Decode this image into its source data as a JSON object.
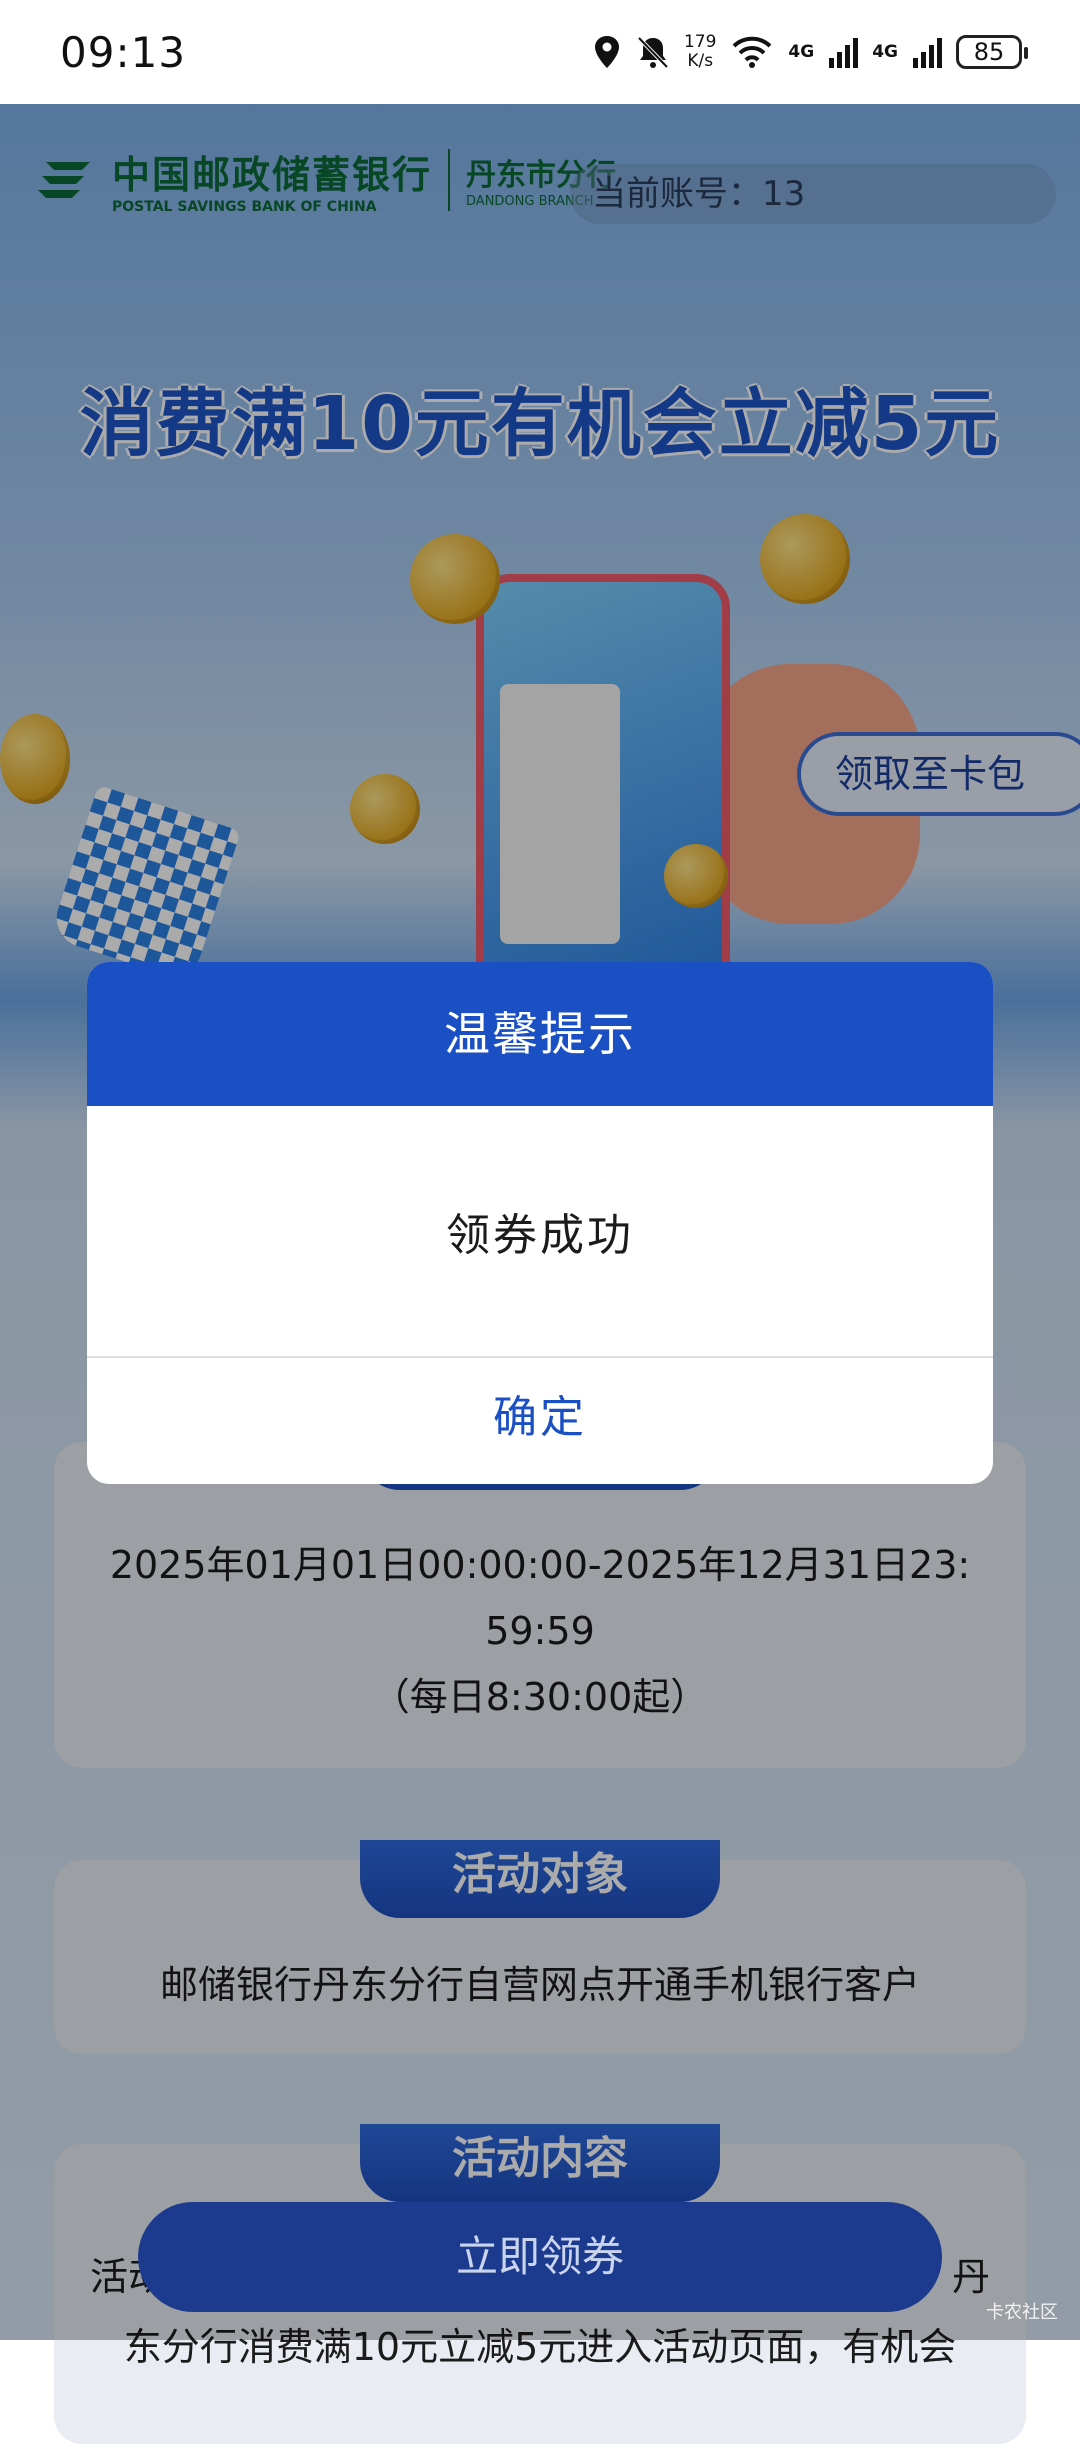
{
  "status_bar": {
    "time": "09:13",
    "speed_value": "179",
    "speed_unit": "K/s",
    "net1": "4G",
    "net2": "4G",
    "battery": "85"
  },
  "header": {
    "bank_cn": "中国邮政储蓄银行",
    "bank_en": "POSTAL SAVINGS BANK OF CHINA",
    "branch_cn": "丹东市分行",
    "branch_en": "DANDONG BRANCH",
    "account_label": "当前账号：",
    "account_value": "13"
  },
  "banner": {
    "title": "消费满10元有机会立减5元",
    "wallet_button": "领取至卡包"
  },
  "time_card": {
    "line1": "2025年01月01日00:00:00-2025年12月31日23:",
    "line2": "59:59",
    "line3": "（每日8:30:00起）"
  },
  "target_card": {
    "tag": "活动对象",
    "text": "邮储银行丹东分行自营网点开通手机银行客户"
  },
  "content_card": {
    "tag": "活动内容",
    "line1_start": "活动",
    "line1_end": "丹",
    "line2": "东分行消费满10元立减5元进入活动页面，有机会"
  },
  "bottom": {
    "claim_button": "立即领券"
  },
  "dialog": {
    "title": "温馨提示",
    "message": "领券成功",
    "confirm": "确定"
  },
  "watermark": "卡农社区",
  "colors": {
    "dialog_header": "#1b4fc4",
    "brand_green": "#0b6b3a",
    "accent_blue": "#1f55c9"
  }
}
